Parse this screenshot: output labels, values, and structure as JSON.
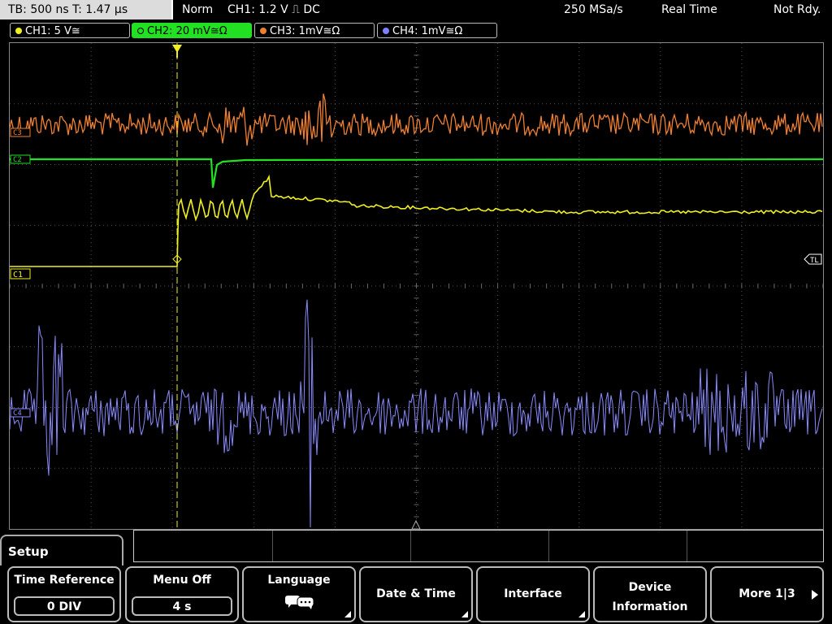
{
  "status": {
    "timebase": "TB: 500 ns   T: 1.47 µs",
    "trigger_mode": "Norm",
    "trigger_info": "CH1: 1.2 V  ⎍ DC",
    "sample_rate": "250 MSa/s",
    "acq_mode": "Real Time",
    "state": "Not Rdy."
  },
  "channels": [
    {
      "label": "CH1: 5 V≅",
      "color": "#f0f020"
    },
    {
      "label": "CH2: 20 mV≅Ω",
      "color": "#22e022"
    },
    {
      "label": "CH3: 1mV≅Ω",
      "color": "#f08030"
    },
    {
      "label": "CH4: 1mV≅Ω",
      "color": "#8080ff"
    }
  ],
  "markers": {
    "c1": "C1",
    "c2": "C2",
    "c3": "C3",
    "c4": "C4",
    "tl": "TL"
  },
  "menu": {
    "title": "Setup",
    "keys": [
      {
        "label": "Time Reference",
        "value": "0 DIV"
      },
      {
        "label": "Menu Off",
        "value": "4 s"
      },
      {
        "label": "Language"
      },
      {
        "label": "Date & Time"
      },
      {
        "label": "Interface"
      },
      {
        "label": "Device",
        "label2": "Information"
      },
      {
        "label": "More 1|3"
      }
    ]
  }
}
